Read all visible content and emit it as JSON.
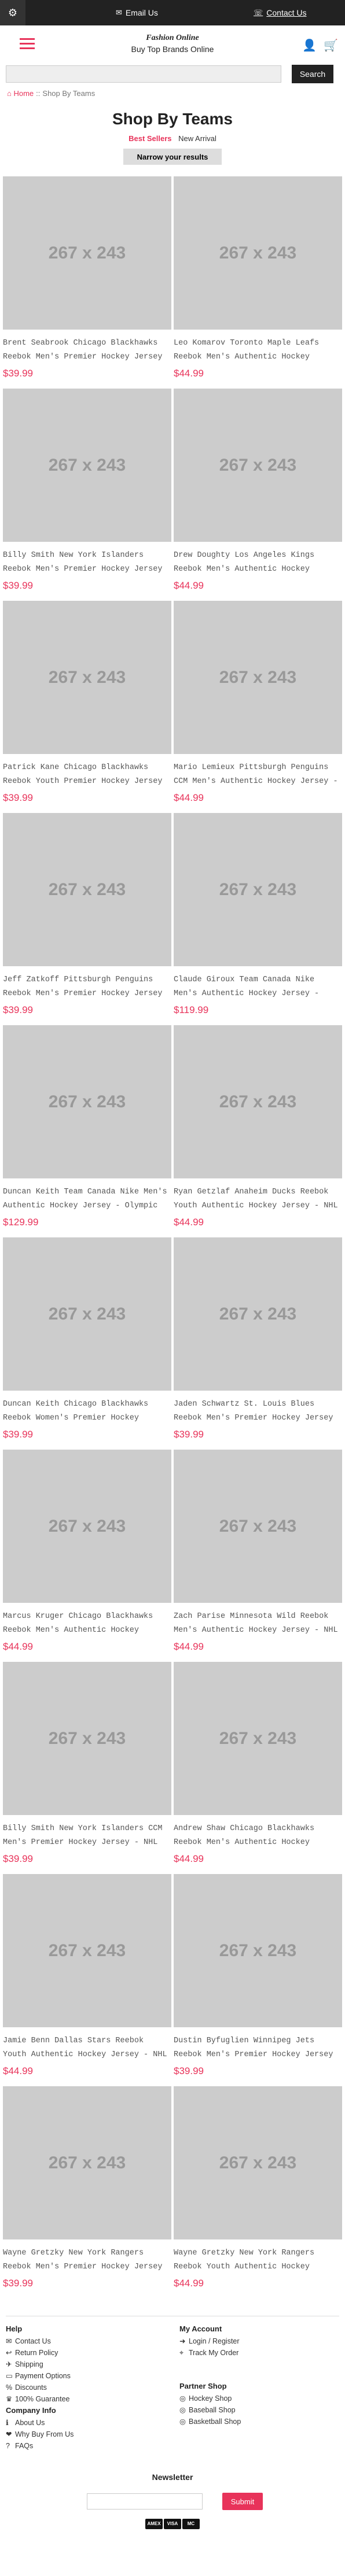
{
  "topbar": {
    "gear_icon": "gear-icon",
    "email_label": "Email Us",
    "contact_label": "Contact Us"
  },
  "header": {
    "brand_title": "Fashion Online",
    "brand_tagline": "Buy Top Brands Online"
  },
  "search": {
    "placeholder": "",
    "button_label": "Search"
  },
  "breadcrumb": {
    "home": "Home",
    "separator": "::",
    "current": "Shop By Teams"
  },
  "page": {
    "title": "Shop By Teams",
    "sort_active": "Best Sellers",
    "sort_other": "New Arrival",
    "narrow_button": "Narrow your results"
  },
  "products": [
    {
      "img": "267 x 243",
      "name": "Brent Seabrook Chicago Blackhawks Reebok Men's Premier Hockey Jersey",
      "price": "$39.99"
    },
    {
      "img": "267 x 243",
      "name": "Leo Komarov Toronto Maple Leafs Reebok Men's Authentic Hockey",
      "price": "$44.99"
    },
    {
      "img": "267 x 243",
      "name": "Billy Smith New York Islanders Reebok Men's Premier Hockey Jersey",
      "price": "$39.99"
    },
    {
      "img": "267 x 243",
      "name": "Drew Doughty Los Angeles Kings Reebok Men's Authentic Hockey",
      "price": "$44.99"
    },
    {
      "img": "267 x 243",
      "name": "Patrick Kane Chicago Blackhawks Reebok Youth Premier Hockey Jersey",
      "price": "$39.99"
    },
    {
      "img": "267 x 243",
      "name": "Mario Lemieux Pittsburgh Penguins CCM Men's Authentic Hockey Jersey -",
      "price": "$44.99"
    },
    {
      "img": "267 x 243",
      "name": "Jeff Zatkoff Pittsburgh Penguins Reebok Men's Premier Hockey Jersey",
      "price": "$39.99"
    },
    {
      "img": "267 x 243",
      "name": "Claude Giroux Team Canada Nike Men's Authentic Hockey Jersey -",
      "price": "$119.99"
    },
    {
      "img": "267 x 243",
      "name": "Duncan Keith Team Canada Nike Men's Authentic Hockey Jersey - Olympic",
      "price": "$129.99"
    },
    {
      "img": "267 x 243",
      "name": "Ryan Getzlaf Anaheim Ducks Reebok Youth Authentic Hockey Jersey - NHL",
      "price": "$44.99"
    },
    {
      "img": "267 x 243",
      "name": "Duncan Keith Chicago Blackhawks Reebok Women's Premier Hockey",
      "price": "$39.99"
    },
    {
      "img": "267 x 243",
      "name": "Jaden Schwartz St. Louis Blues Reebok Men's Premier Hockey Jersey",
      "price": "$39.99"
    },
    {
      "img": "267 x 243",
      "name": "Marcus Kruger Chicago Blackhawks Reebok Men's Authentic Hockey",
      "price": "$44.99"
    },
    {
      "img": "267 x 243",
      "name": "Zach Parise Minnesota Wild Reebok Men's Authentic Hockey Jersey - NHL",
      "price": "$44.99"
    },
    {
      "img": "267 x 243",
      "name": "Billy Smith New York Islanders CCM Men's Premier Hockey Jersey - NHL",
      "price": "$39.99"
    },
    {
      "img": "267 x 243",
      "name": "Andrew Shaw Chicago Blackhawks Reebok Men's Authentic Hockey",
      "price": "$44.99"
    },
    {
      "img": "267 x 243",
      "name": "Jamie Benn Dallas Stars Reebok Youth Authentic Hockey Jersey - NHL",
      "price": "$44.99"
    },
    {
      "img": "267 x 243",
      "name": "Dustin Byfuglien Winnipeg Jets Reebok Men's Premier Hockey Jersey",
      "price": "$39.99"
    },
    {
      "img": "267 x 243",
      "name": "Wayne Gretzky New York Rangers Reebok Men's Premier Hockey Jersey",
      "price": "$39.99"
    },
    {
      "img": "267 x 243",
      "name": "Wayne Gretzky New York Rangers Reebok Youth Authentic Hockey",
      "price": "$44.99"
    }
  ],
  "footer": {
    "help_title": "Help",
    "help_items": [
      "Contact Us",
      "Return Policy",
      "Shipping",
      "Payment Options",
      "Discounts",
      "100% Guarantee"
    ],
    "company_title": "Company Info",
    "company_items": [
      "About Us",
      "Why Buy From Us",
      "FAQs"
    ],
    "account_title": "My Account",
    "account_items": [
      "Login / Register",
      "Track My Order"
    ],
    "partner_title": "Partner Shop",
    "partner_items": [
      "Hockey Shop",
      "Baseball Shop",
      "Basketball Shop"
    ],
    "newsletter_title": "Newsletter",
    "newsletter_placeholder": "",
    "newsletter_button": "Submit",
    "payment_methods": [
      "AMEX",
      "VISA",
      "MC"
    ]
  },
  "colors": {
    "accent": "#e8335a",
    "topbar": "#222222"
  }
}
